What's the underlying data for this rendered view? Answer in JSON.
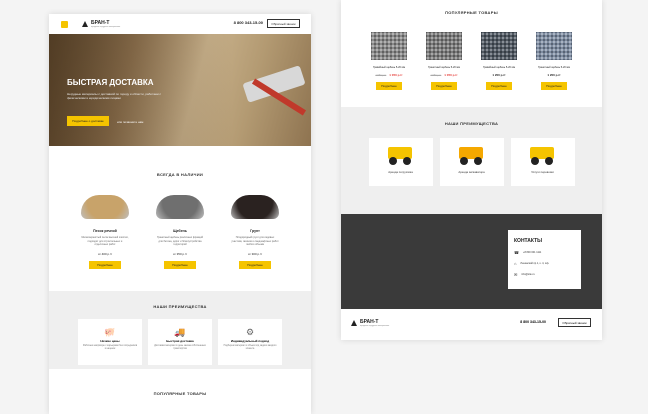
{
  "header": {
    "logo": "БРАН-Т",
    "tagline": "продажа нерудных материалов",
    "phone": "8 800 343-15-00",
    "cta": "Обратный звонок"
  },
  "hero": {
    "title": "БЫСТРАЯ ДОСТАВКА",
    "text": "Нерудные материалы с доставкой по городу и области, работаем с физическими и юридическими лицами",
    "button": "Подробнее о доставке",
    "note": "или позвоните нам"
  },
  "in_stock": {
    "title": "ВСЕГДА В НАЛИЧИИ",
    "items": [
      {
        "name": "Песок речной",
        "desc": "Мелкозернистый песок высшей очистки, подходит для строительных и отделочных работ",
        "price": "от 400 р./т",
        "button": "Подробнее",
        "color": "#c8a36a"
      },
      {
        "name": "Щебень",
        "desc": "Гранитный щебень различных фракций для бетона, дорог и благоустройства территорий",
        "price": "от 350 р./т",
        "button": "Подробнее",
        "color": "#6f6f6f"
      },
      {
        "name": "Грунт",
        "desc": "Плодородный грунт для садовых участков, газонов и ландшафтных работ любого объема",
        "price": "от 300 р./т",
        "button": "Подробнее",
        "color": "#2a2220"
      }
    ]
  },
  "advantages_left": {
    "title": "НАШИ ПРЕИМУЩЕСТВА",
    "items": [
      {
        "icon": "piggy-bank-icon",
        "glyph": "🐖",
        "title": "Низкие цены",
        "desc": "Работаем напрямую с карьерами без посредников и наценок"
      },
      {
        "icon": "truck-icon",
        "glyph": "🚚",
        "title": "Быстрая доставка",
        "desc": "Доставим материал в день заказа собственным транспортом"
      },
      {
        "icon": "gear-icon",
        "glyph": "⚙",
        "title": "Индивидуальный подход",
        "desc": "Подберем материал и объем под задачи каждого клиента"
      }
    ]
  },
  "popular": {
    "title": "ПОПУЛЯРНЫЕ ТОВАРЫ",
    "items": [
      {
        "name": "Гравийный щебень 5-20 мм",
        "old": "1 550 р./т",
        "new": "1 050 р./т",
        "button": "Подробнее",
        "color": "#8a8a8a"
      },
      {
        "name": "Гранитный щебень 5-20 мм",
        "old": "1 550 р./т",
        "new": "1 050 р./т",
        "button": "Подробнее",
        "color": "#7b7b7b"
      },
      {
        "name": "Гравийный щебень 5-20 мм",
        "old": "",
        "new": "1 200 р./т",
        "button": "Подробнее",
        "color": "#4d5660"
      },
      {
        "name": "Гранитный щебень 5-20 мм",
        "old": "",
        "new": "1 200 р./т",
        "button": "Подробнее",
        "color": "#7d8ca3"
      }
    ]
  },
  "advantages_right": {
    "title": "НАШИ ПРЕИМУЩЕСТВА",
    "items": [
      {
        "title": "Аренда погрузчика",
        "color": "#f5c400"
      },
      {
        "title": "Аренда экскаватора",
        "color": "#f5a800"
      },
      {
        "title": "Услуги перевозки",
        "color": "#f5c400"
      }
    ]
  },
  "contacts": {
    "title": "КОНТАКТЫ",
    "phone": "+8 800 001 1111",
    "address": "Ленинский пр.1, к. 4, оф.",
    "email": "info@site.ru"
  },
  "footer": {
    "logo": "БРАН-Т",
    "tagline": "продажа нерудных материалов",
    "phone": "8 800 343-15-00",
    "cta": "Обратный звонок"
  }
}
